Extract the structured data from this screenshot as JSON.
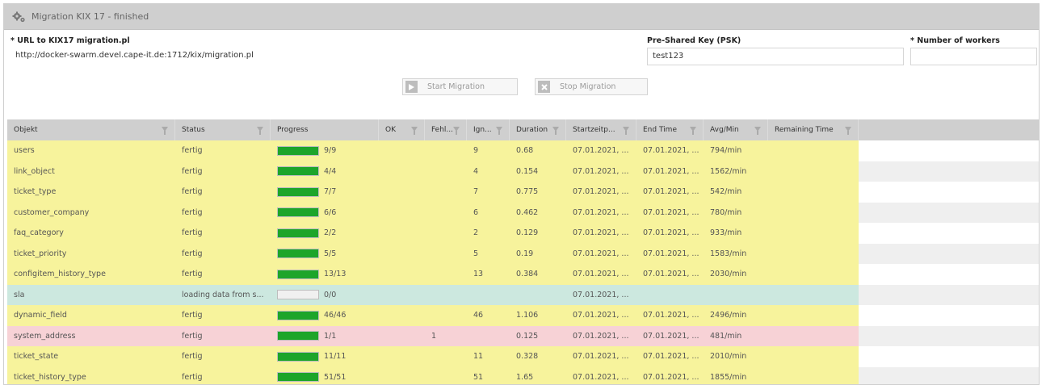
{
  "window": {
    "title": "Migration KIX 17 - finished",
    "icon": "gears-icon"
  },
  "form": {
    "url": {
      "label": "* URL to KIX17 migration.pl",
      "value": "http://docker-swarm.devel.cape-it.de:1712/kix/migration.pl"
    },
    "psk": {
      "label": "Pre-Shared Key (PSK)",
      "value": "test123"
    },
    "workers": {
      "label": "* Number of workers",
      "value": ""
    }
  },
  "buttons": {
    "start": {
      "label": "Start Migration",
      "icon": "play-icon"
    },
    "stop": {
      "label": "Stop Migration",
      "icon": "close-icon"
    }
  },
  "table": {
    "columns": [
      "Objekt",
      "Status",
      "Progress",
      "OK",
      "Fehl...",
      "Ign...",
      "Duration",
      "Startzeitp...",
      "End Time",
      "Avg/Min",
      "Remaining Time"
    ],
    "rows": [
      {
        "objekt": "users",
        "status": "fertig",
        "progress": 1,
        "progress_text": "9/9",
        "ok": "",
        "fehl": "",
        "ign": "9",
        "duration": "0.68",
        "start": "07.01.2021, ...",
        "end": "07.01.2021, ...",
        "avg": "794/min",
        "remaining": "",
        "color": "yellow"
      },
      {
        "objekt": "link_object",
        "status": "fertig",
        "progress": 1,
        "progress_text": "4/4",
        "ok": "",
        "fehl": "",
        "ign": "4",
        "duration": "0.154",
        "start": "07.01.2021, ...",
        "end": "07.01.2021, ...",
        "avg": "1562/min",
        "remaining": "",
        "color": "yellow"
      },
      {
        "objekt": "ticket_type",
        "status": "fertig",
        "progress": 1,
        "progress_text": "7/7",
        "ok": "",
        "fehl": "",
        "ign": "7",
        "duration": "0.775",
        "start": "07.01.2021, ...",
        "end": "07.01.2021, ...",
        "avg": "542/min",
        "remaining": "",
        "color": "yellow"
      },
      {
        "objekt": "customer_company",
        "status": "fertig",
        "progress": 1,
        "progress_text": "6/6",
        "ok": "",
        "fehl": "",
        "ign": "6",
        "duration": "0.462",
        "start": "07.01.2021, ...",
        "end": "07.01.2021, ...",
        "avg": "780/min",
        "remaining": "",
        "color": "yellow"
      },
      {
        "objekt": "faq_category",
        "status": "fertig",
        "progress": 1,
        "progress_text": "2/2",
        "ok": "",
        "fehl": "",
        "ign": "2",
        "duration": "0.129",
        "start": "07.01.2021, ...",
        "end": "07.01.2021, ...",
        "avg": "933/min",
        "remaining": "",
        "color": "yellow"
      },
      {
        "objekt": "ticket_priority",
        "status": "fertig",
        "progress": 1,
        "progress_text": "5/5",
        "ok": "",
        "fehl": "",
        "ign": "5",
        "duration": "0.19",
        "start": "07.01.2021, ...",
        "end": "07.01.2021, ...",
        "avg": "1583/min",
        "remaining": "",
        "color": "yellow"
      },
      {
        "objekt": "configitem_history_type",
        "status": "fertig",
        "progress": 1,
        "progress_text": "13/13",
        "ok": "",
        "fehl": "",
        "ign": "13",
        "duration": "0.384",
        "start": "07.01.2021, ...",
        "end": "07.01.2021, ...",
        "avg": "2030/min",
        "remaining": "",
        "color": "yellow"
      },
      {
        "objekt": "sla",
        "status": "loading data from s...",
        "progress": 0,
        "progress_text": "0/0",
        "ok": "",
        "fehl": "",
        "ign": "",
        "duration": "",
        "start": "07.01.2021, ...",
        "end": "",
        "avg": "",
        "remaining": "",
        "color": "green"
      },
      {
        "objekt": "dynamic_field",
        "status": "fertig",
        "progress": 1,
        "progress_text": "46/46",
        "ok": "",
        "fehl": "",
        "ign": "46",
        "duration": "1.106",
        "start": "07.01.2021, ...",
        "end": "07.01.2021, ...",
        "avg": "2496/min",
        "remaining": "",
        "color": "yellow"
      },
      {
        "objekt": "system_address",
        "status": "fertig",
        "progress": 1,
        "progress_text": "1/1",
        "ok": "",
        "fehl": "1",
        "ign": "",
        "duration": "0.125",
        "start": "07.01.2021, ...",
        "end": "07.01.2021, ...",
        "avg": "481/min",
        "remaining": "",
        "color": "red"
      },
      {
        "objekt": "ticket_state",
        "status": "fertig",
        "progress": 1,
        "progress_text": "11/11",
        "ok": "",
        "fehl": "",
        "ign": "11",
        "duration": "0.328",
        "start": "07.01.2021, ...",
        "end": "07.01.2021, ...",
        "avg": "2010/min",
        "remaining": "",
        "color": "yellow"
      },
      {
        "objekt": "ticket_history_type",
        "status": "fertig",
        "progress": 1,
        "progress_text": "51/51",
        "ok": "",
        "fehl": "",
        "ign": "51",
        "duration": "1.65",
        "start": "07.01.2021, ...",
        "end": "07.01.2021, ...",
        "avg": "1855/min",
        "remaining": "",
        "color": "yellow"
      }
    ]
  },
  "colors": {
    "progress_fill": "#1da52a",
    "row_yellow": "#f7f39c",
    "row_green": "#cce8df",
    "row_red": "#f7d2d6",
    "header_bg": "#cfcfcf"
  }
}
